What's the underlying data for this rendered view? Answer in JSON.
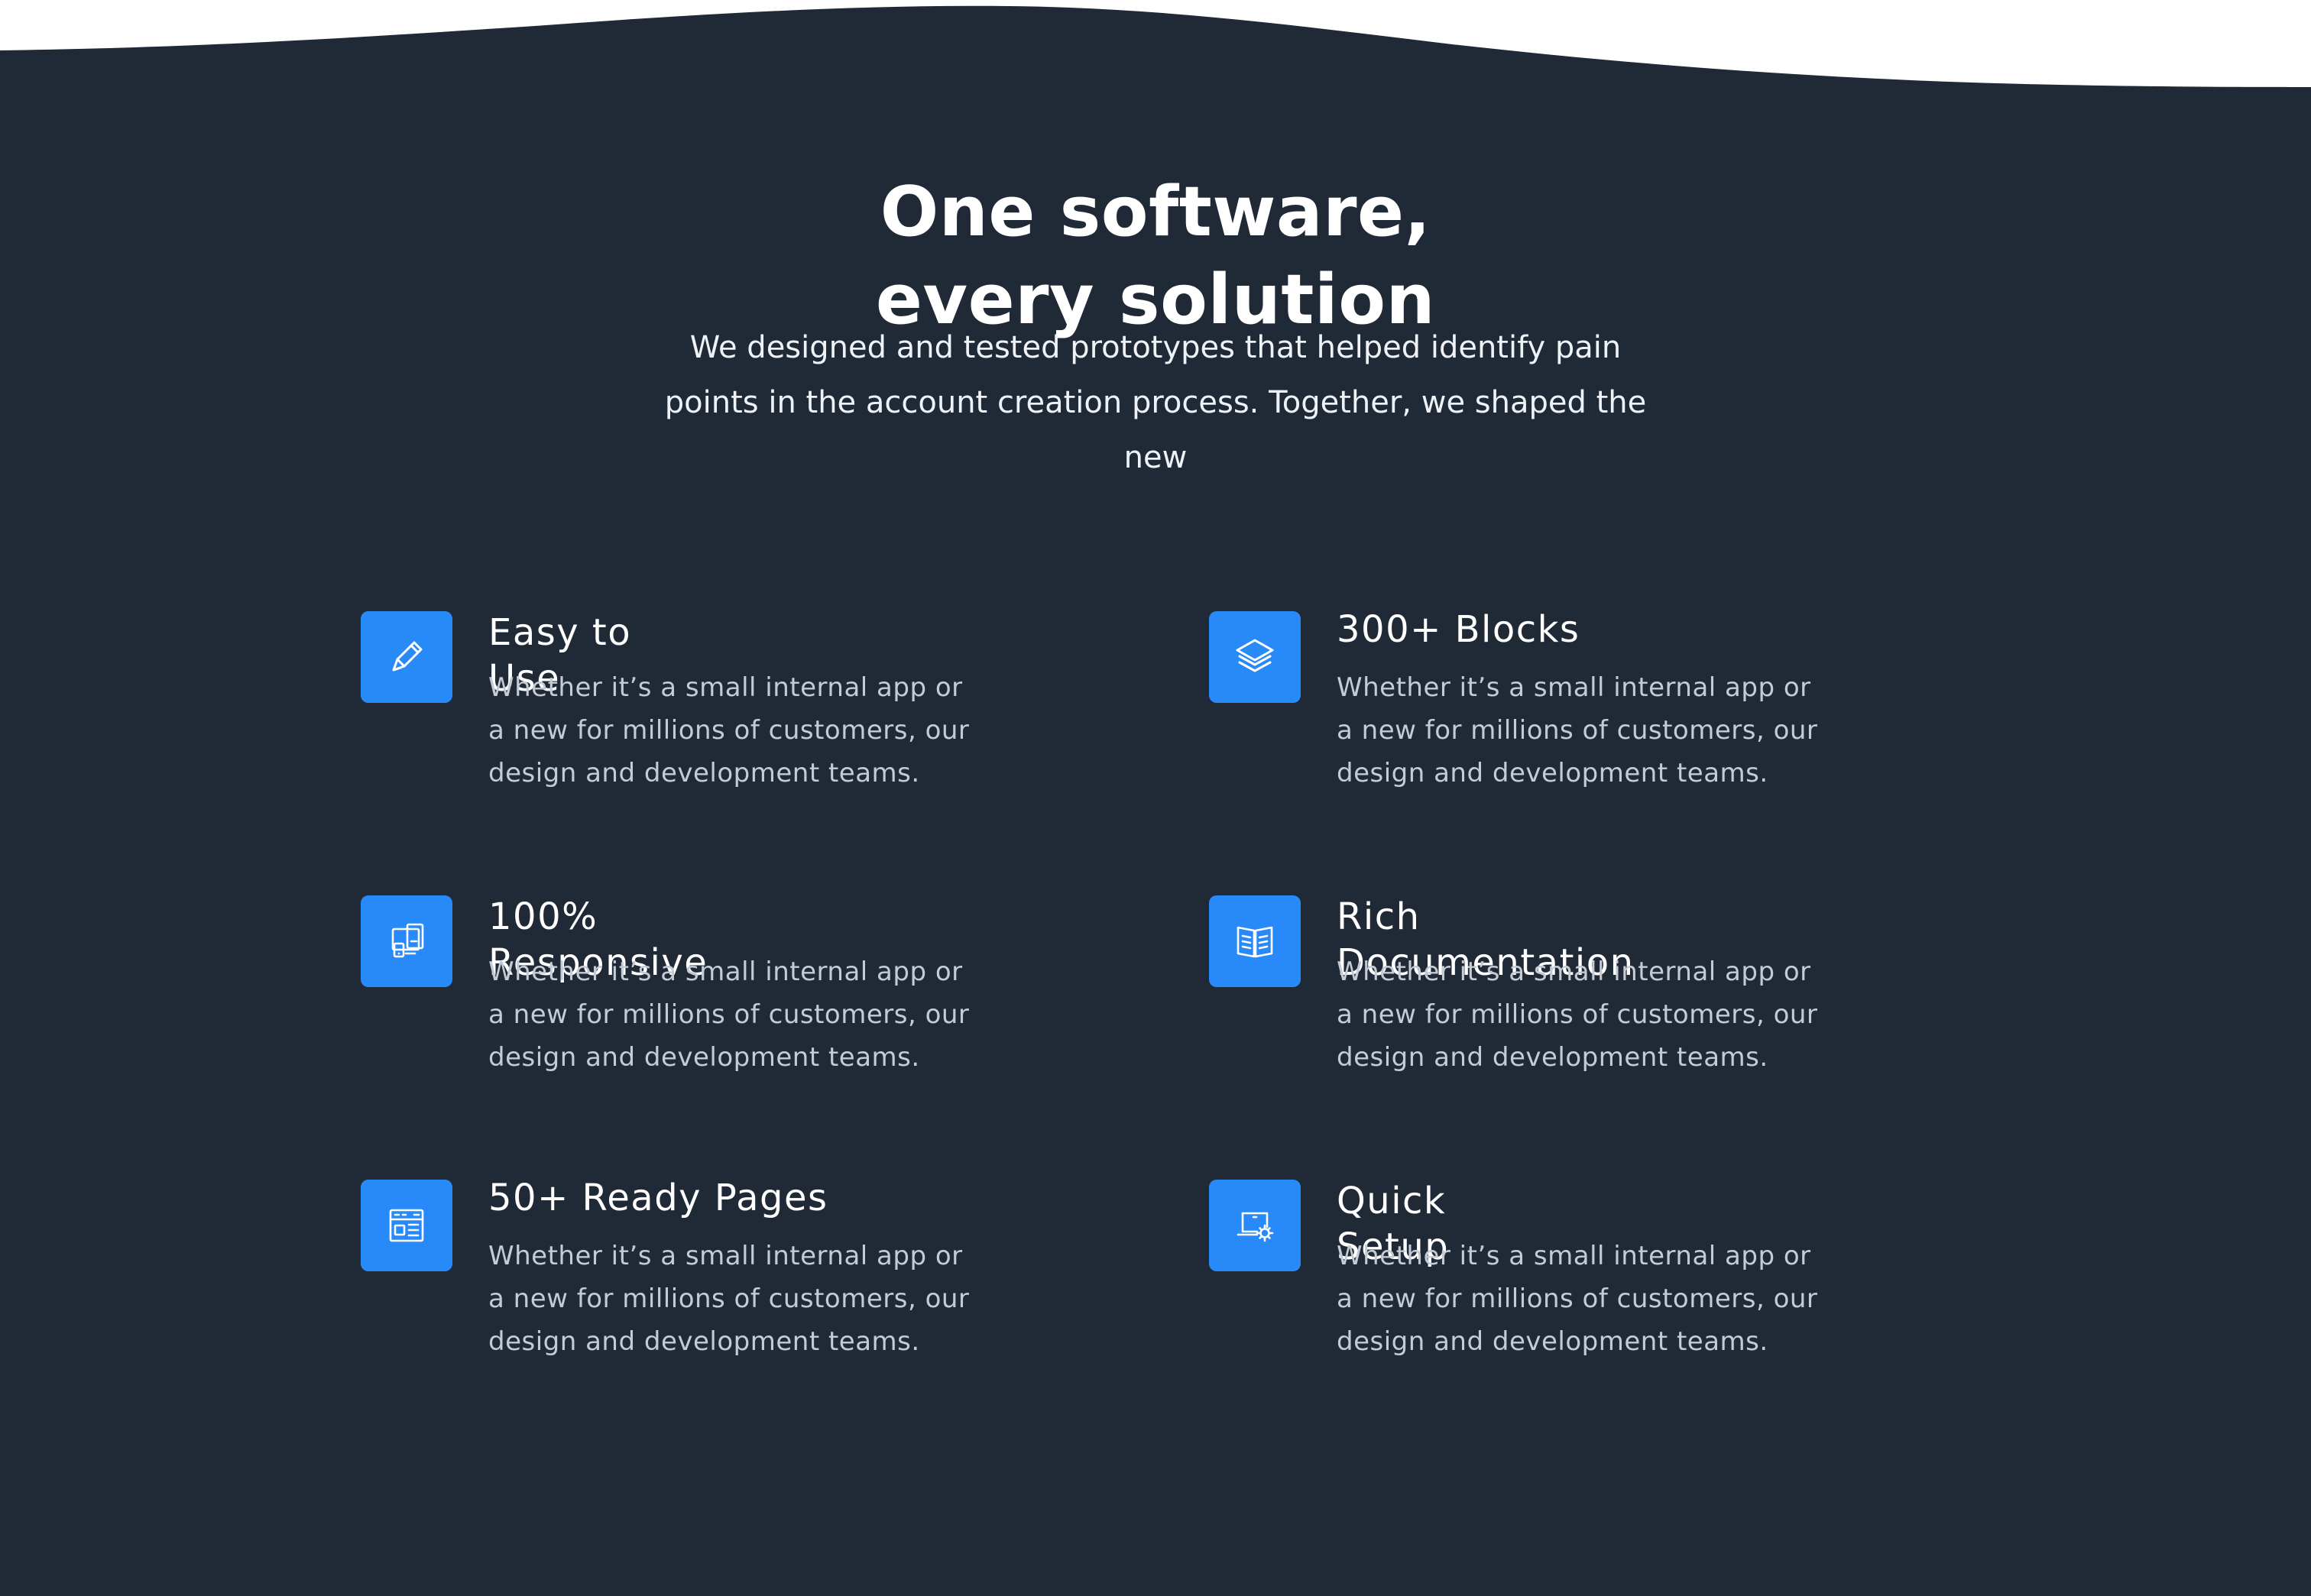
{
  "colors": {
    "background": "#202936",
    "accent": "#288af8",
    "heading_text": "#ffffff",
    "body_text": "#c5cbd5"
  },
  "section": {
    "title": "One software, every solution",
    "subtitle": "We designed and tested prototypes that helped identify pain points in the account creation process. Together, we shaped the new"
  },
  "features": [
    {
      "icon": "pencil-icon",
      "title": "Easy to Use",
      "description": "Whether it’s a small internal app or a new for millions of customers, our design and development teams."
    },
    {
      "icon": "layers-icon",
      "title": "300+ Blocks",
      "description": "Whether it’s a small internal app or a new for millions of customers, our design and development teams."
    },
    {
      "icon": "devices-icon",
      "title": "100% Responsive",
      "description": "Whether it’s a small internal app or a new for millions of customers, our design and development teams."
    },
    {
      "icon": "book-icon",
      "title": "Rich Documentation",
      "description": "Whether it’s a small internal app or a new for millions of customers, our design and development teams."
    },
    {
      "icon": "page-layout-icon",
      "title": "50+ Ready Pages",
      "description": "Whether it’s a small internal app or a new for millions of customers, our design and development teams."
    },
    {
      "icon": "laptop-settings-icon",
      "title": "Quick Setup",
      "description": "Whether it’s a small internal app or a new for millions of customers, our design and development teams."
    }
  ]
}
